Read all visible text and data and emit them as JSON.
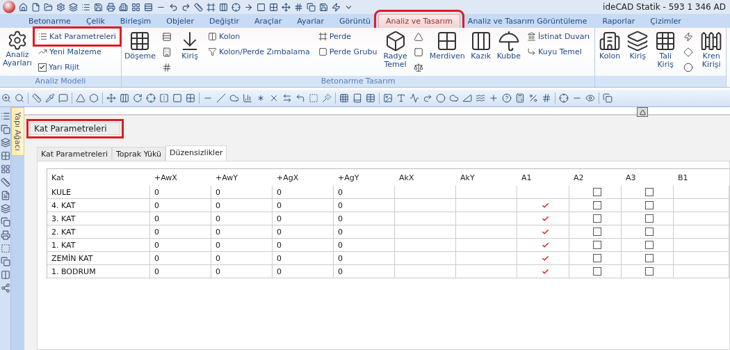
{
  "title_bar": {
    "title": "ideCAD Statik - 593 1 346 AD"
  },
  "ribbon": {
    "tabs": [
      {
        "label": "Betonarme",
        "selected": false,
        "highlighted": false
      },
      {
        "label": "Çelik",
        "selected": false,
        "highlighted": false
      },
      {
        "label": "Birleşim",
        "selected": false,
        "highlighted": false
      },
      {
        "label": "Objeler",
        "selected": false,
        "highlighted": false
      },
      {
        "label": "Değiştir",
        "selected": false,
        "highlighted": false
      },
      {
        "label": "Araçlar",
        "selected": false,
        "highlighted": false
      },
      {
        "label": "Ayarlar",
        "selected": false,
        "highlighted": false
      },
      {
        "label": "Görüntü",
        "selected": false,
        "highlighted": false
      },
      {
        "label": "Analiz ve Tasarım",
        "selected": true,
        "highlighted": true
      },
      {
        "label": "Analiz ve Tasarım Görüntüleme",
        "selected": false,
        "highlighted": false
      },
      {
        "label": "Raporlar",
        "selected": false,
        "highlighted": false
      },
      {
        "label": "Çizimler",
        "selected": false,
        "highlighted": false
      }
    ],
    "groups": [
      {
        "label": "Analiz Modeli",
        "columns": [
          [
            {
              "kind": "large",
              "label": "Analiz Ayarları"
            }
          ],
          [
            {
              "kind": "small",
              "label": "Kat Parametreleri",
              "highlighted": true
            },
            {
              "kind": "small",
              "label": "Yeni Malzeme",
              "highlighted": false
            },
            {
              "kind": "check",
              "label": "Yarı Rijit",
              "checked": true
            }
          ]
        ]
      },
      {
        "label": "Betonarme Tasarım",
        "columns": [
          [
            {
              "kind": "large",
              "label": "Döşeme"
            }
          ],
          [
            {
              "kind": "icon"
            },
            {
              "kind": "icon"
            },
            {
              "kind": "icon"
            }
          ],
          [
            {
              "kind": "large",
              "label": "Kiriş"
            }
          ],
          [
            {
              "kind": "small",
              "label": "Kolon",
              "highlighted": false
            },
            {
              "kind": "small",
              "label": "Kolon/Perde Zımbalama",
              "highlighted": false
            }
          ],
          [
            {
              "kind": "small",
              "label": "Perde",
              "highlighted": false
            },
            {
              "kind": "small",
              "label": "Perde Grubu",
              "highlighted": false
            }
          ],
          [
            {
              "kind": "large",
              "label": "Radye Temel"
            }
          ],
          [
            {
              "kind": "icon"
            },
            {
              "kind": "icon"
            },
            {
              "kind": "icon"
            }
          ],
          [
            {
              "kind": "large",
              "label": "Merdiven"
            }
          ],
          [
            {
              "kind": "large",
              "label": "Kazık"
            }
          ],
          [
            {
              "kind": "large",
              "label": "Kubbe"
            }
          ],
          [
            {
              "kind": "small",
              "label": "İstinat Duvarı",
              "highlighted": false
            },
            {
              "kind": "small",
              "label": "Kuyu Temel",
              "highlighted": false
            }
          ]
        ]
      },
      {
        "columns": [
          [
            {
              "kind": "large",
              "label": "Kolon"
            }
          ],
          [
            {
              "kind": "large",
              "label": "Kiriş"
            }
          ],
          [
            {
              "kind": "large",
              "label": "Tali Kiriş"
            }
          ],
          [
            {
              "kind": "icon"
            },
            {
              "kind": "icon"
            },
            {
              "kind": "icon"
            }
          ],
          [
            {
              "kind": "large",
              "label": "Kren Kirişi"
            }
          ]
        ]
      }
    ]
  },
  "sidebar": {
    "tab_label": "Yapı Ağacı"
  },
  "panel": {
    "title": "Kat Parametreleri",
    "title_highlighted": true,
    "tabs": [
      {
        "label": "Kat Parametreleri",
        "selected": false
      },
      {
        "label": "Toprak Yükü",
        "selected": false
      },
      {
        "label": "Düzensizlikler",
        "selected": true
      }
    ],
    "table": {
      "columns": [
        {
          "label": "Kat",
          "kind": "text"
        },
        {
          "label": "+AwX",
          "kind": "text"
        },
        {
          "label": "+AwY",
          "kind": "text"
        },
        {
          "label": "+AgX",
          "kind": "text"
        },
        {
          "label": "+AgY",
          "kind": "text"
        },
        {
          "label": "AkX",
          "kind": "text"
        },
        {
          "label": "AkY",
          "kind": "text"
        },
        {
          "label": "A1",
          "kind": "tick"
        },
        {
          "label": "A2",
          "kind": "checkbox"
        },
        {
          "label": "A3",
          "kind": "checkbox"
        },
        {
          "label": "B1",
          "kind": "text"
        }
      ],
      "rows": [
        {
          "cells": [
            "KULE",
            "0",
            "0",
            "0",
            "0",
            "",
            "",
            false,
            false,
            false,
            ""
          ]
        },
        {
          "cells": [
            "4. KAT",
            "0",
            "0",
            "0",
            "0",
            "",
            "",
            true,
            false,
            false,
            ""
          ]
        },
        {
          "cells": [
            "3. KAT",
            "0",
            "0",
            "0",
            "0",
            "",
            "",
            true,
            false,
            false,
            ""
          ]
        },
        {
          "cells": [
            "2. KAT",
            "0",
            "0",
            "0",
            "0",
            "",
            "",
            true,
            false,
            false,
            ""
          ]
        },
        {
          "cells": [
            "1. KAT",
            "0",
            "0",
            "0",
            "0",
            "",
            "",
            true,
            false,
            false,
            ""
          ]
        },
        {
          "cells": [
            "ZEMİN KAT",
            "0",
            "0",
            "0",
            "0",
            "",
            "",
            true,
            false,
            false,
            ""
          ]
        },
        {
          "cells": [
            "1. BODRUM",
            "0",
            "0",
            "0",
            "0",
            "",
            "",
            true,
            false,
            false,
            ""
          ]
        }
      ]
    }
  }
}
